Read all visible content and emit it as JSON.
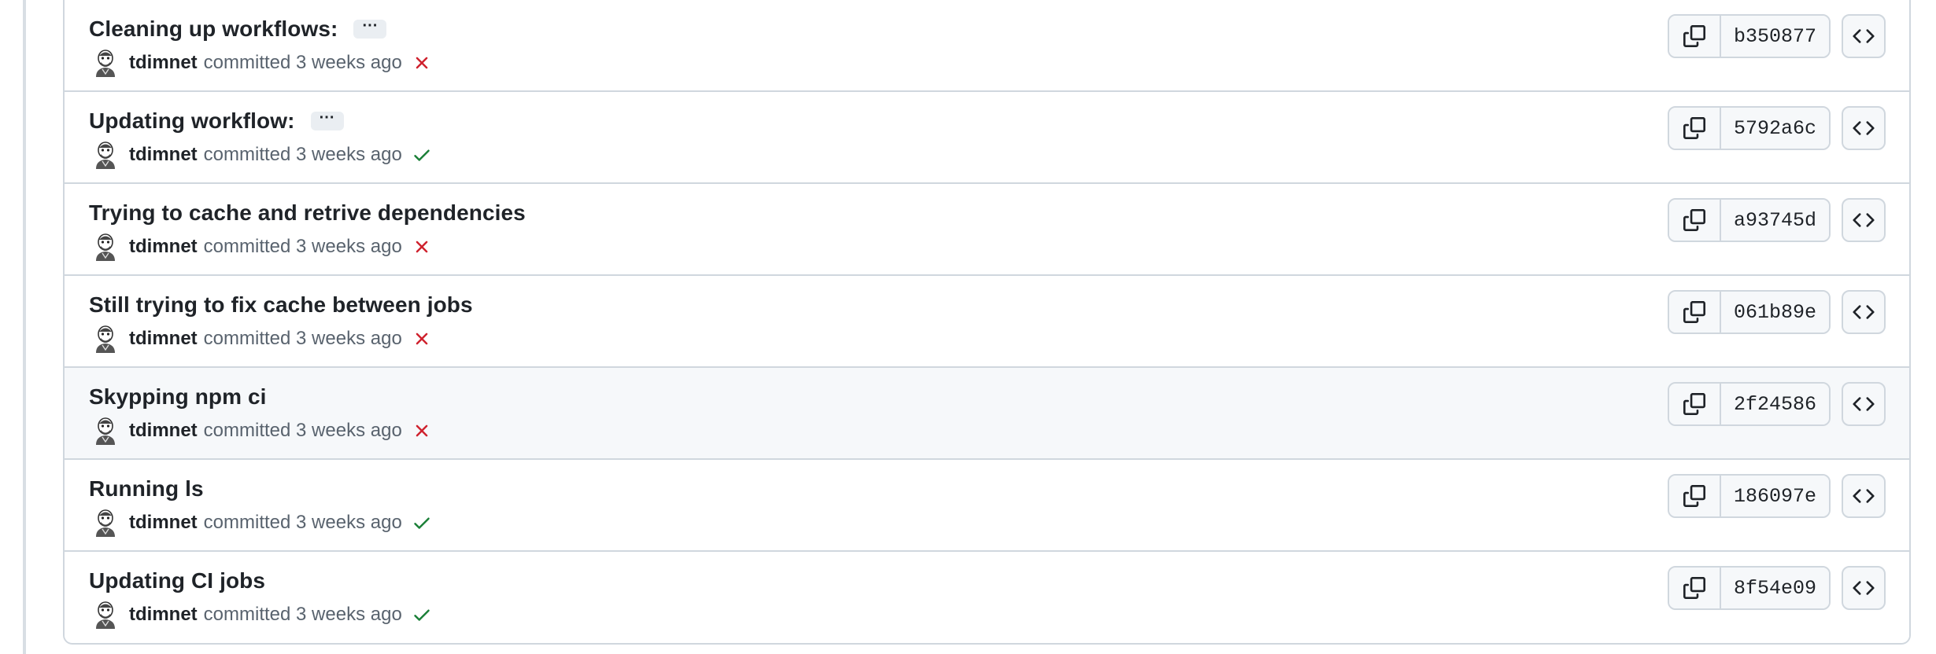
{
  "commits": [
    {
      "title": "Cleaning up workflows:",
      "has_more": true,
      "more_label": "···",
      "author": "tdimnet",
      "when": "committed 3 weeks ago",
      "status": "failure",
      "sha": "b350877",
      "hover": false
    },
    {
      "title": "Updating workflow:",
      "has_more": true,
      "more_label": "···",
      "author": "tdimnet",
      "when": "committed 3 weeks ago",
      "status": "success",
      "sha": "5792a6c",
      "hover": false
    },
    {
      "title": "Trying to cache and retrive dependencies",
      "has_more": false,
      "author": "tdimnet",
      "when": "committed 3 weeks ago",
      "status": "failure",
      "sha": "a93745d",
      "hover": false
    },
    {
      "title": "Still trying to fix cache between jobs",
      "has_more": false,
      "author": "tdimnet",
      "when": "committed 3 weeks ago",
      "status": "failure",
      "sha": "061b89e",
      "hover": false
    },
    {
      "title": "Skypping npm ci",
      "has_more": false,
      "author": "tdimnet",
      "when": "committed 3 weeks ago",
      "status": "failure",
      "sha": "2f24586",
      "hover": true
    },
    {
      "title": "Running ls",
      "has_more": false,
      "author": "tdimnet",
      "when": "committed 3 weeks ago",
      "status": "success",
      "sha": "186097e",
      "hover": false
    },
    {
      "title": "Updating CI jobs",
      "has_more": false,
      "author": "tdimnet",
      "when": "committed 3 weeks ago",
      "status": "success",
      "sha": "8f54e09",
      "hover": false
    }
  ],
  "icons": {
    "copy": "copy-icon",
    "browse": "code-icon",
    "success": "check-icon",
    "failure": "x-icon",
    "avatar": "avatar"
  },
  "colors": {
    "success": "#1a7f37",
    "failure": "#cf222e",
    "border": "#d0d7de",
    "muted_text": "#59636e",
    "hover_bg": "#f6f8fa"
  }
}
